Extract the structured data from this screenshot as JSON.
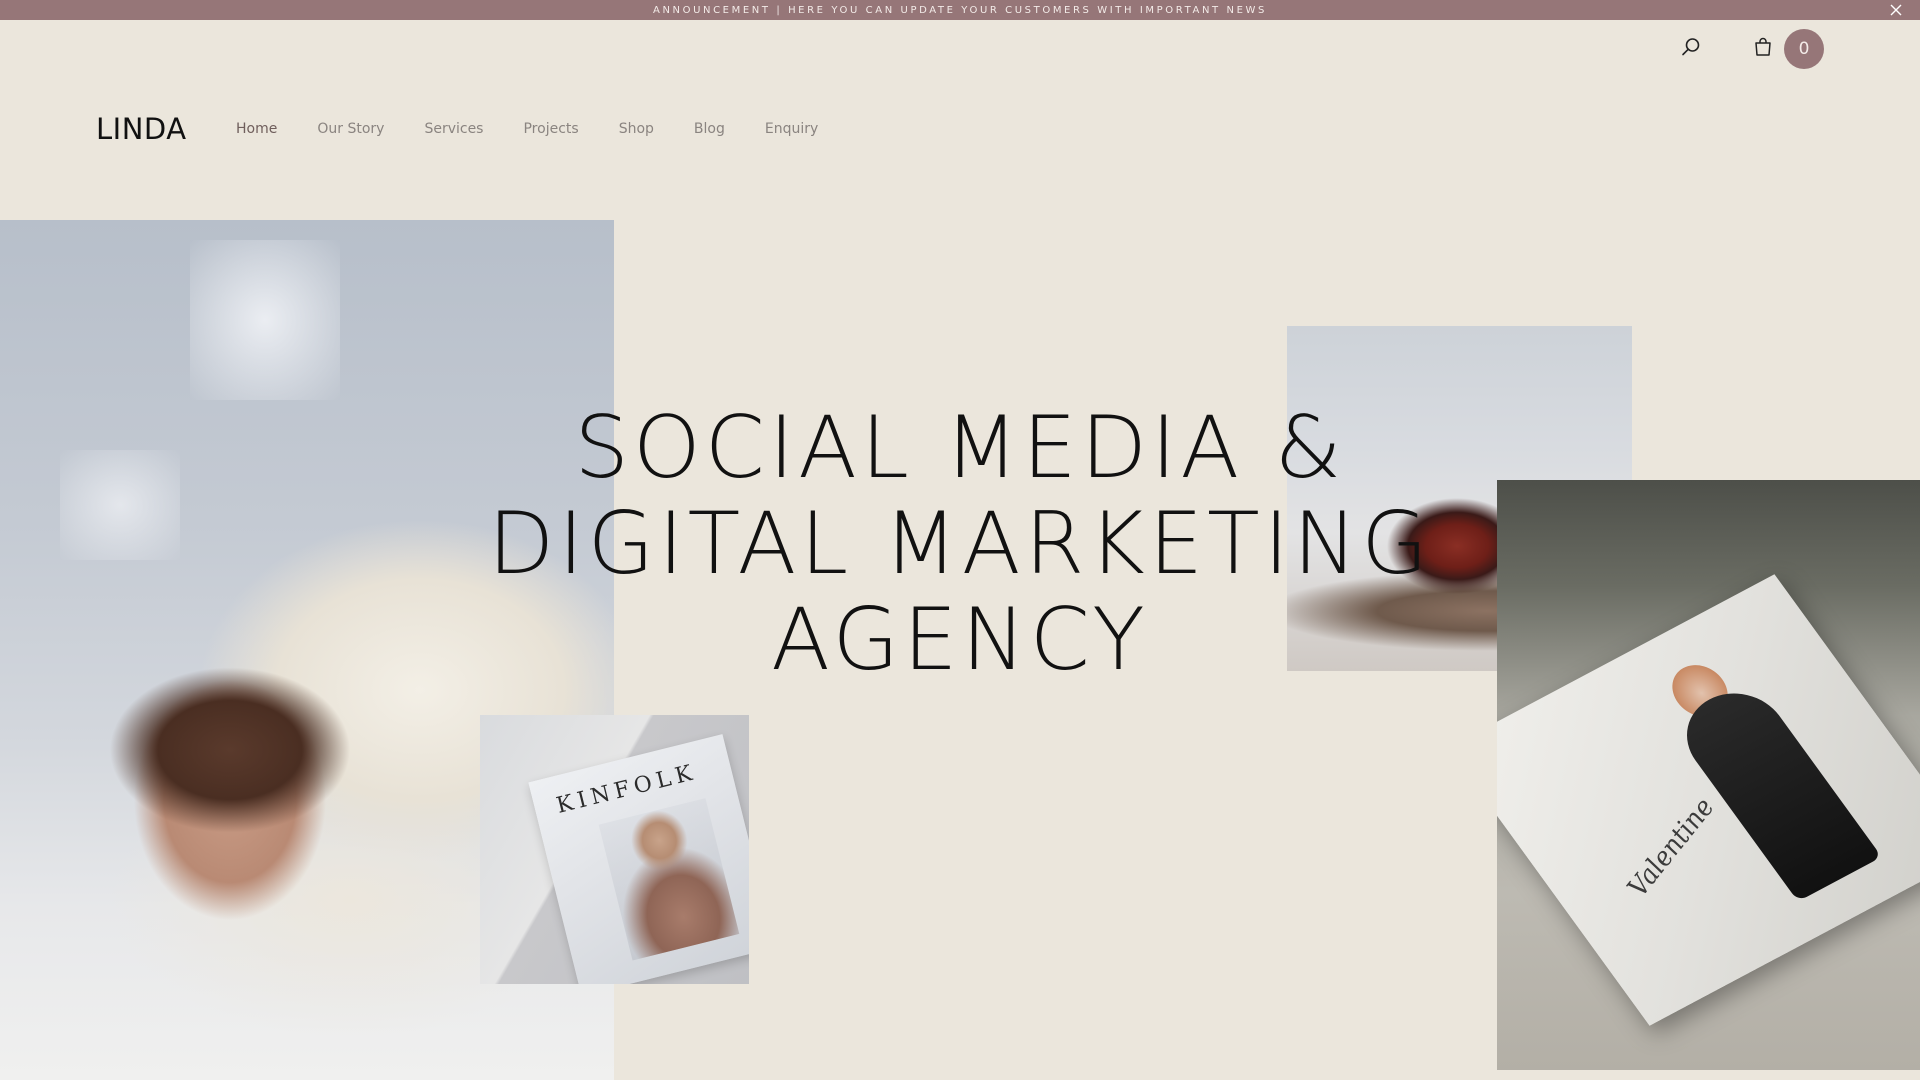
{
  "announcement": {
    "text": "ANNOUNCEMENT | HERE YOU CAN UPDATE YOUR CUSTOMERS WITH IMPORTANT NEWS",
    "close_icon": "close-icon"
  },
  "header": {
    "search_icon": "search-icon",
    "cart_icon": "shopping-bag-icon",
    "cart_count": "0"
  },
  "brand": {
    "logo": "LINDA"
  },
  "nav": {
    "items": [
      {
        "label": "Home",
        "active": true
      },
      {
        "label": "Our Story"
      },
      {
        "label": "Services"
      },
      {
        "label": "Projects"
      },
      {
        "label": "Shop"
      },
      {
        "label": "Blog"
      },
      {
        "label": "Enquiry"
      }
    ]
  },
  "hero": {
    "line1": "SOCIAL MEDIA &",
    "line2": "DIGITAL MARKETING",
    "line3": "AGENCY",
    "kinfolk_title": "KINFOLK",
    "valentine_title": "Valentine"
  },
  "colors": {
    "background": "#ebe6dc",
    "accent": "#967678"
  }
}
